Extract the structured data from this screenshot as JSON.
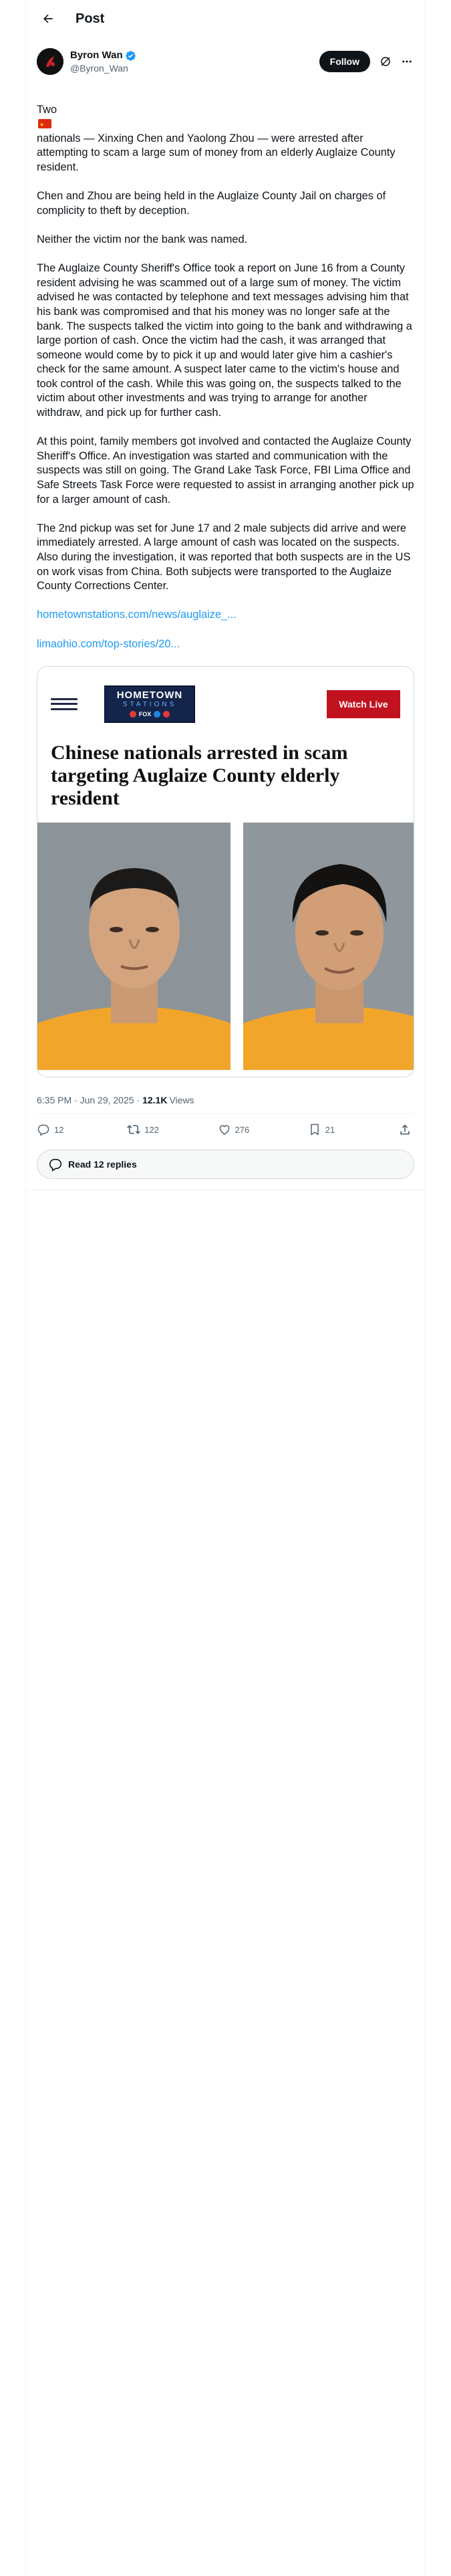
{
  "header": {
    "title": "Post"
  },
  "author": {
    "name": "Byron Wan",
    "handle": "@Byron_Wan",
    "follow_label": "Follow"
  },
  "post": {
    "p1_before": "Two",
    "p1_after": "nationals — Xinxing Chen and Yaolong Zhou — were arrested after attempting to scam a large sum of money from an elderly Auglaize County resident.",
    "p2": "Chen and Zhou are being held in the Auglaize County Jail on charges of complicity to theft by deception.",
    "p3": "Neither the victim nor the bank was named.",
    "p4": "The Auglaize County Sheriff's Office took a report on June 16 from a County resident advising he was scammed out of a large sum of money. The victim advised he was contacted by telephone and text messages advising him that his bank was compromised and that his money was no longer safe at the bank. The suspects talked the victim into going to the bank and withdrawing a large portion of cash. Once the victim had the cash, it was arranged that someone would come by to pick it up and would later give him a cashier's check for the same amount. A suspect later came to the victim's house and took control of the cash. While this was going on, the suspects talked to the victim about other investments and was trying to arrange for another withdraw, and pick up for further cash.",
    "p5": "At this point, family members got involved and contacted the Auglaize County Sheriff's Office. An investigation was started and communication with the suspects was still on going. The Grand Lake Task Force, FBI Lima Office and Safe Streets Task Force were requested to assist in arranging another pick up for a larger amount of cash.",
    "p6": "The 2nd pickup was set for June 17 and 2 male subjects did arrive and were immediately arrested. A large amount of cash was located on the suspects. Also during the investigation, it was reported that both suspects are in the US on work visas from China. Both subjects were transported to the Auglaize County Corrections Center.",
    "link1": "hometownstations.com/news/auglaize_...",
    "link2": "limaohio.com/top-stories/20..."
  },
  "card": {
    "logo_top": "HOMETOWN",
    "logo_mid": "STATIONS",
    "logo_fox": "FOX",
    "watch_live": "Watch Live",
    "headline": "Chinese nationals arrested in scam targeting Auglaize County elderly resident"
  },
  "meta": {
    "timestamp": "6:35 PM · Jun 29, 2025 ·",
    "views_count": "12.1K",
    "views_label": "Views"
  },
  "actions": {
    "replies": "12",
    "reposts": "122",
    "likes": "276",
    "bookmarks": "21"
  },
  "read_replies": "Read 12 replies",
  "colors": {
    "accent": "#1d9bf0",
    "watch_live": "#c1121f",
    "logo_bg": "#14244a"
  }
}
